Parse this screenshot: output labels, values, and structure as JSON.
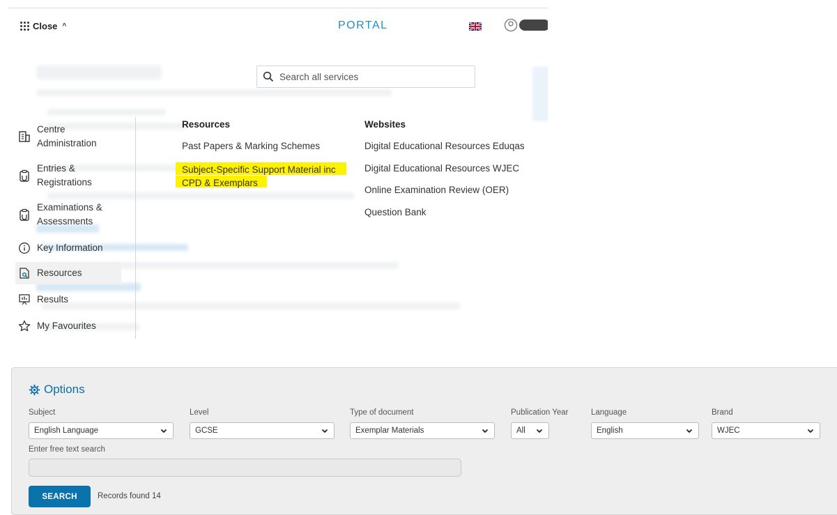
{
  "header": {
    "close_label": "Close",
    "brand": "PORTAL",
    "search_placeholder": "Search all services"
  },
  "nav": {
    "items": [
      {
        "label_line1": "Centre",
        "label_line2": "Administration",
        "icon": "building-icon"
      },
      {
        "label_line1": "Entries &",
        "label_line2": "Registrations",
        "icon": "clipboard-icon"
      },
      {
        "label_line1": "Examinations &",
        "label_line2": "Assessments",
        "icon": "clipboard-icon"
      },
      {
        "label_line1": "Key Information",
        "icon": "info-icon"
      },
      {
        "label_line1": "Resources",
        "icon": "document-search-icon",
        "active": true
      },
      {
        "label_line1": "Results",
        "icon": "presentation-icon"
      },
      {
        "label_line1": "My Favourites",
        "icon": "star-icon"
      }
    ]
  },
  "resources": {
    "heading": "Resources",
    "links": [
      {
        "label": "Past Papers & Marking Schemes"
      },
      {
        "label_line1": "Subject-Specific Support Material inc",
        "label_line2": "CPD & Exemplars",
        "highlighted": true
      }
    ]
  },
  "websites": {
    "heading": "Websites",
    "links": [
      "Digital Educational Resources Eduqas",
      "Digital Educational Resources WJEC",
      "Online Examination Review (OER)",
      "Question Bank"
    ]
  },
  "options": {
    "title": "Options",
    "filters": {
      "subject": {
        "label": "Subject",
        "value": "English Language"
      },
      "level": {
        "label": "Level",
        "value": "GCSE"
      },
      "doc_type": {
        "label": "Type of document",
        "value": "Exemplar Materials"
      },
      "year": {
        "label": "Publication Year",
        "value": "All"
      },
      "language": {
        "label": "Language",
        "value": "English"
      },
      "brand": {
        "label": "Brand",
        "value": "WJEC"
      }
    },
    "free_text_label": "Enter free text search",
    "free_text_value": "",
    "search_button": "SEARCH",
    "records_found": "Records found 14"
  },
  "colors": {
    "accent": "#1f8fc7",
    "button": "#0b73ab",
    "highlight": "#fff200",
    "options_title": "#0a6fa8"
  }
}
